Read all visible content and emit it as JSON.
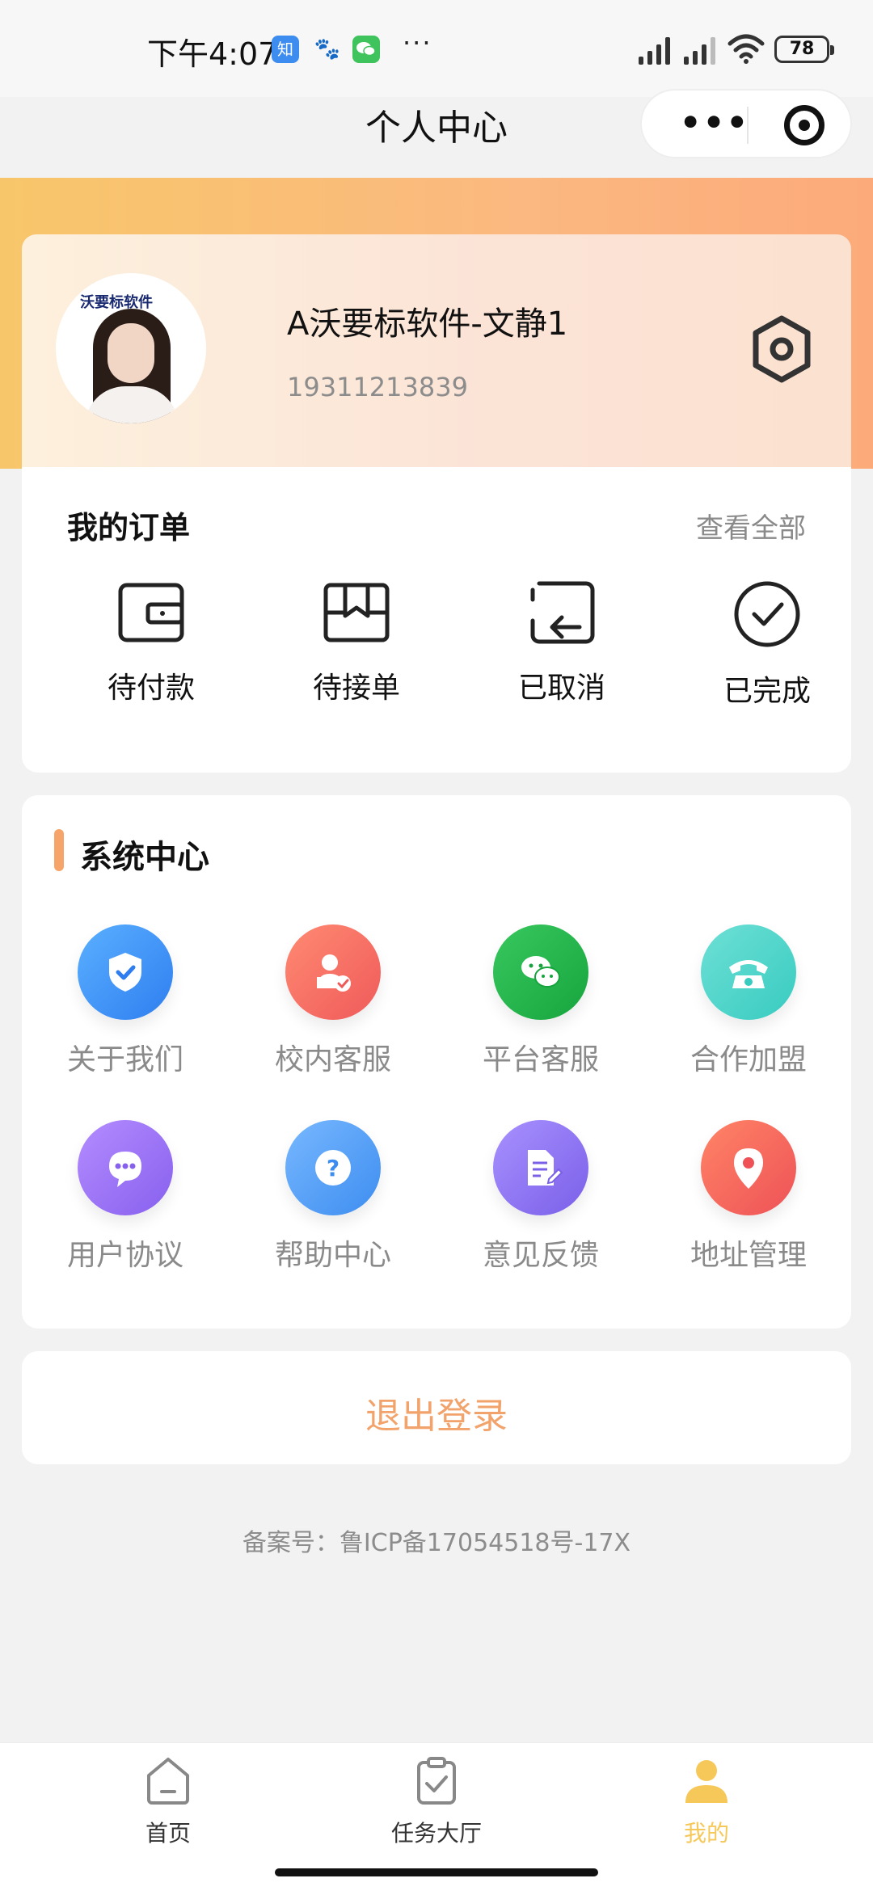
{
  "status_bar": {
    "time": "下午4:07",
    "zhihu_label": "知",
    "more": "···",
    "battery": "78"
  },
  "nav": {
    "title": "个人中心",
    "capsule_more": "•••"
  },
  "profile": {
    "avatar_logo": "沃要标软件",
    "name": "A沃要标软件-文静1",
    "phone": "19311213839"
  },
  "orders": {
    "title": "我的订单",
    "view_all": "查看全部",
    "items": [
      {
        "label": "待付款",
        "icon": "wallet-icon"
      },
      {
        "label": "待接单",
        "icon": "box-icon"
      },
      {
        "label": "已取消",
        "icon": "return-icon"
      },
      {
        "label": "已完成",
        "icon": "check-circle-icon"
      }
    ]
  },
  "system": {
    "title": "系统中心",
    "items": [
      {
        "label": "关于我们",
        "icon": "shield-check-icon",
        "color": "#3b8ff0"
      },
      {
        "label": "校内客服",
        "icon": "user-check-icon",
        "color": "#f26c5e"
      },
      {
        "label": "平台客服",
        "icon": "wechat-icon",
        "color": "#22b04a"
      },
      {
        "label": "合作加盟",
        "icon": "telephone-icon",
        "color": "#3fd2c8"
      },
      {
        "label": "用户协议",
        "icon": "chat-bubble-icon",
        "color": "#9b6ef0"
      },
      {
        "label": "帮助中心",
        "icon": "question-icon",
        "color": "#4d9df5"
      },
      {
        "label": "意见反馈",
        "icon": "document-edit-icon",
        "color": "#8a6ef0"
      },
      {
        "label": "地址管理",
        "icon": "location-pin-icon",
        "color": "#f2665a"
      }
    ]
  },
  "logout": {
    "label": "退出登录",
    "color": "#f2a36b"
  },
  "icp": "备案号：鲁ICP备17054518号-17X",
  "tabs": [
    {
      "label": "首页",
      "icon": "home-icon",
      "active": false
    },
    {
      "label": "任务大厅",
      "icon": "clipboard-check-icon",
      "active": false
    },
    {
      "label": "我的",
      "icon": "person-icon",
      "active": true
    }
  ],
  "colors": {
    "accent_orange": "#f7a46a",
    "active_tab": "#f6c85a",
    "band_start": "#f8c66a",
    "band_end": "#fcaa7a"
  }
}
